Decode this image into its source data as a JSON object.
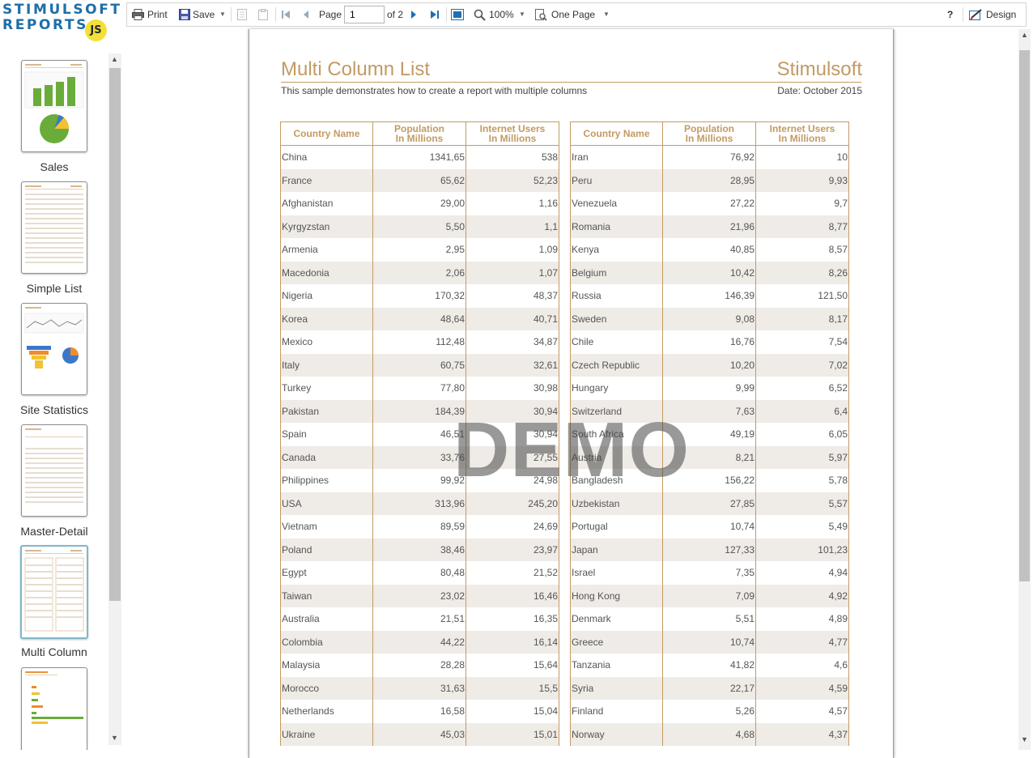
{
  "logo": {
    "line1": "STIMULSOFT",
    "line2": "REPORTS",
    "badge": "JS"
  },
  "toolbar": {
    "print_label": "Print",
    "save_label": "Save",
    "page_label": "Page",
    "page_value": "1",
    "page_of": "of 2",
    "zoom_label": "100%",
    "view_mode_label": "One Page",
    "help_label": "?",
    "design_label": "Design"
  },
  "sidebar": {
    "items": [
      {
        "label": "Sales",
        "icon": "sales-thumbnail"
      },
      {
        "label": "Simple List",
        "icon": "simple-list-thumbnail"
      },
      {
        "label": "Site Statistics",
        "icon": "site-statistics-thumbnail"
      },
      {
        "label": "Master-Detail",
        "icon": "master-detail-thumbnail"
      },
      {
        "label": "Multi Column",
        "icon": "multi-column-thumbnail",
        "selected": true
      },
      {
        "label": "",
        "icon": "bar-chart-thumbnail"
      }
    ]
  },
  "report": {
    "title": "Multi Column List",
    "brand": "Stimulsoft",
    "subtitle": "This sample demonstrates how to create a report with multiple columns",
    "date": "Date: October 2015",
    "watermark": "DEMO",
    "columns": {
      "country": "Country Name",
      "population_1": "Population",
      "population_2": "In Millions",
      "internet_1": "Internet Users",
      "internet_2": "In Millions"
    },
    "left_rows": [
      [
        "China",
        "1341,65",
        "538"
      ],
      [
        "France",
        "65,62",
        "52,23"
      ],
      [
        "Afghanistan",
        "29,00",
        "1,16"
      ],
      [
        "Kyrgyzstan",
        "5,50",
        "1,1"
      ],
      [
        "Armenia",
        "2,95",
        "1,09"
      ],
      [
        "Macedonia",
        "2,06",
        "1,07"
      ],
      [
        "Nigeria",
        "170,32",
        "48,37"
      ],
      [
        "Korea",
        "48,64",
        "40,71"
      ],
      [
        "Mexico",
        "112,48",
        "34,87"
      ],
      [
        "Italy",
        "60,75",
        "32,61"
      ],
      [
        "Turkey",
        "77,80",
        "30,98"
      ],
      [
        "Pakistan",
        "184,39",
        "30,94"
      ],
      [
        "Spain",
        "46,51",
        "30,94"
      ],
      [
        "Canada",
        "33,76",
        "27,55"
      ],
      [
        "Philippines",
        "99,92",
        "24,98"
      ],
      [
        "USA",
        "313,96",
        "245,20"
      ],
      [
        "Vietnam",
        "89,59",
        "24,69"
      ],
      [
        "Poland",
        "38,46",
        "23,97"
      ],
      [
        "Egypt",
        "80,48",
        "21,52"
      ],
      [
        "Taiwan",
        "23,02",
        "16,46"
      ],
      [
        "Australia",
        "21,51",
        "16,35"
      ],
      [
        "Colombia",
        "44,22",
        "16,14"
      ],
      [
        "Malaysia",
        "28,28",
        "15,64"
      ],
      [
        "Morocco",
        "31,63",
        "15,5"
      ],
      [
        "Netherlands",
        "16,58",
        "15,04"
      ],
      [
        "Ukraine",
        "45,03",
        "15,01"
      ]
    ],
    "right_rows": [
      [
        "Iran",
        "76,92",
        "10"
      ],
      [
        "Peru",
        "28,95",
        "9,93"
      ],
      [
        "Venezuela",
        "27,22",
        "9,7"
      ],
      [
        "Romania",
        "21,96",
        "8,77"
      ],
      [
        "Kenya",
        "40,85",
        "8,57"
      ],
      [
        "Belgium",
        "10,42",
        "8,26"
      ],
      [
        "Russia",
        "146,39",
        "121,50"
      ],
      [
        "Sweden",
        "9,08",
        "8,17"
      ],
      [
        "Chile",
        "16,76",
        "7,54"
      ],
      [
        "Czech Republic",
        "10,20",
        "7,02"
      ],
      [
        "Hungary",
        "9,99",
        "6,52"
      ],
      [
        "Switzerland",
        "7,63",
        "6,4"
      ],
      [
        "South Africa",
        "49,19",
        "6,05"
      ],
      [
        "Austria",
        "8,21",
        "5,97"
      ],
      [
        "Bangladesh",
        "156,22",
        "5,78"
      ],
      [
        "Uzbekistan",
        "27,85",
        "5,57"
      ],
      [
        "Portugal",
        "10,74",
        "5,49"
      ],
      [
        "Japan",
        "127,33",
        "101,23"
      ],
      [
        "Israel",
        "7,35",
        "4,94"
      ],
      [
        "Hong Kong",
        "7,09",
        "4,92"
      ],
      [
        "Denmark",
        "5,51",
        "4,89"
      ],
      [
        "Greece",
        "10,74",
        "4,77"
      ],
      [
        "Tanzania",
        "41,82",
        "4,6"
      ],
      [
        "Syria",
        "22,17",
        "4,59"
      ],
      [
        "Finland",
        "5,26",
        "4,57"
      ],
      [
        "Norway",
        "4,68",
        "4,37"
      ]
    ]
  },
  "colors": {
    "accent": "#c39a63",
    "row_alt": "#efebe6",
    "logo_blue": "#1d6fa8",
    "logo_badge": "#f3e03a"
  }
}
